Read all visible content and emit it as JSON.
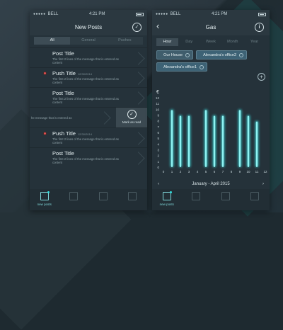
{
  "screen1": {
    "status": {
      "carrier": "BELL",
      "time": "4:21 PM"
    },
    "title": "New Posts",
    "segments": [
      "All",
      "General",
      "Pushes"
    ],
    "items": [
      {
        "title": "Post Title",
        "time": "",
        "body": "The first 2 lines of the message that is entered as content",
        "unread": false
      },
      {
        "title": "Push Title",
        "time": "12/30/2014",
        "body": "The first 2 lines of the message that is entered as content",
        "unread": true
      },
      {
        "title": "Post Title",
        "time": "",
        "body": "The first 2 lines of the message that is entered as content",
        "unread": false
      }
    ],
    "swipe": {
      "text": "he message that is entered as",
      "action": "Mark as read"
    },
    "items2": [
      {
        "title": "Push Title",
        "time": "12/30/2014",
        "body": "The first 2 lines of the message that is entered as content",
        "unread": true
      },
      {
        "title": "Post Title",
        "time": "",
        "body": "The first 2 lines of the message that is entered as content",
        "unread": false
      }
    ],
    "tabs": [
      "new posts",
      "",
      "",
      ""
    ]
  },
  "screen2": {
    "status": {
      "carrier": "BELL",
      "time": "4:21 PM"
    },
    "title": "Gas",
    "periods": [
      "Hour",
      "Day",
      "Week",
      "Month",
      "Year"
    ],
    "chips": [
      "Our House",
      "Alexandra's office2",
      "Alexandra's office1"
    ],
    "month_label": "January - April 2015",
    "tabs": [
      "new posts",
      "",
      "",
      ""
    ]
  },
  "chart_data": {
    "type": "bar",
    "title": "",
    "ylabel": "€",
    "ylim": [
      0,
      12
    ],
    "y_ticks": [
      0,
      1,
      2,
      3,
      4,
      5,
      6,
      7,
      8,
      9,
      10,
      11,
      12
    ],
    "categories": [
      "0",
      "1",
      "2",
      "3",
      "4",
      "5",
      "6",
      "7",
      "8",
      "9",
      "10",
      "11",
      "12"
    ],
    "series": [
      {
        "values": [
          0,
          10,
          9,
          9,
          0,
          10,
          9,
          9,
          0,
          10,
          9,
          8,
          0
        ]
      }
    ],
    "colors": {
      "bar": "#8ff3f3",
      "glow": "#39d4d6"
    }
  }
}
